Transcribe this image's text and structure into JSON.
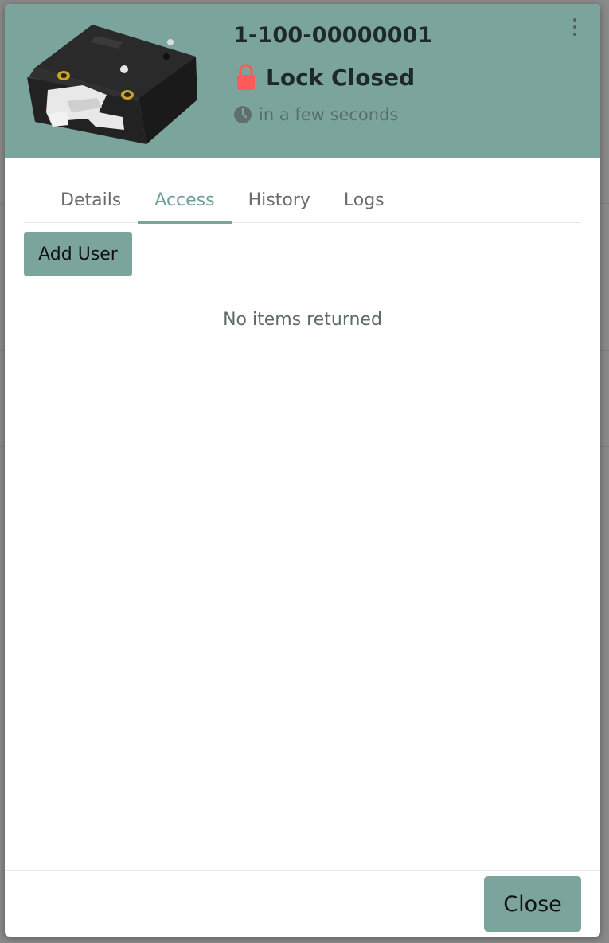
{
  "device": {
    "id": "1-100-00000001",
    "status": "Lock Closed",
    "status_icon": "padlock-closed-icon",
    "status_color": "#ff5a5a",
    "last_update": "in a few seconds",
    "time_icon": "clock-icon"
  },
  "colors": {
    "accent": "#7ba59c",
    "header_bg": "#7ba59c",
    "active_tab": "#6fa096"
  },
  "tabs": [
    {
      "label": "Details",
      "active": false
    },
    {
      "label": "Access",
      "active": true
    },
    {
      "label": "History",
      "active": false
    },
    {
      "label": "Logs",
      "active": false
    }
  ],
  "access": {
    "add_user_label": "Add User",
    "empty_message": "No items returned"
  },
  "footer": {
    "close_label": "Close"
  },
  "header": {
    "menu_icon": "more-vertical-icon"
  }
}
